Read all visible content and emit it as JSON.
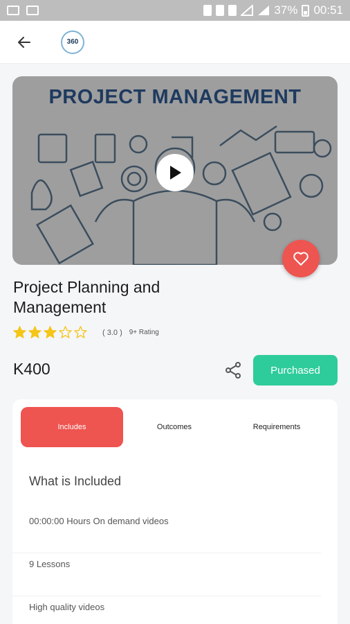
{
  "status_bar": {
    "battery": "37%",
    "time": "00:51"
  },
  "app_bar": {
    "logo_text": "360"
  },
  "video": {
    "title": "PROJECT MANAGEMENT"
  },
  "course": {
    "title": "Project Planning and Management",
    "rating_score": "( 3.0 )",
    "rating_value": 3,
    "rating_max": 5,
    "rating_count": "9+ Rating",
    "price": "K400",
    "purchase_label": "Purchased"
  },
  "tabs": [
    "Includes",
    "Outcomes",
    "Requirements"
  ],
  "includes": {
    "title": "What is Included",
    "items": [
      "00:00:00 Hours On demand videos",
      "9 Lessons",
      "High quality videos"
    ]
  },
  "colors": {
    "accent_red": "#ee5450",
    "accent_green": "#2ecc9a",
    "star": "#f5c518"
  }
}
